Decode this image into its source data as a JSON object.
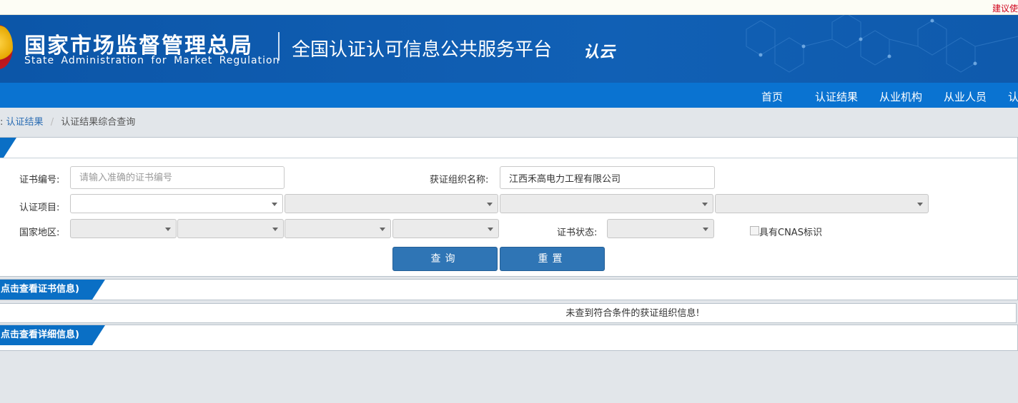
{
  "top_bar": {
    "suggest_text": "建议使"
  },
  "header": {
    "agency_name_cn": "国家市场监督管理总局",
    "agency_name_en": "State Administration  for  Market Regulation",
    "platform_title": "全国认证认可信息公共服务平台",
    "logo_text": "认云"
  },
  "nav": {
    "items": [
      "首页",
      "认证结果",
      "从业机构",
      "从业人员",
      "认"
    ]
  },
  "breadcrumb": {
    "prefix": ":",
    "link": "认证结果",
    "separator": "/",
    "current": "认证结果综合查询"
  },
  "search_form": {
    "cert_no_label": "证书编号:",
    "cert_no_placeholder": "请输入准确的证书编号",
    "org_name_label": "获证组织名称:",
    "org_name_value": "江西禾高电力工程有限公司",
    "project_label": "认证项目:",
    "region_label": "国家地区:",
    "status_label": "证书状态:",
    "cnas_label": "具有CNAS标识",
    "query_button": "查询",
    "reset_button": "重置"
  },
  "results": {
    "cert_section_label": "点击查看证书信息)",
    "empty_message": "未查到符合条件的获证组织信息!",
    "detail_section_label": "点击查看详细信息)"
  },
  "colors": {
    "banner_blue": "#0c56a8",
    "nav_blue": "#0a73d1",
    "button_blue": "#2f75b5",
    "suggest_red": "#d0021b"
  }
}
